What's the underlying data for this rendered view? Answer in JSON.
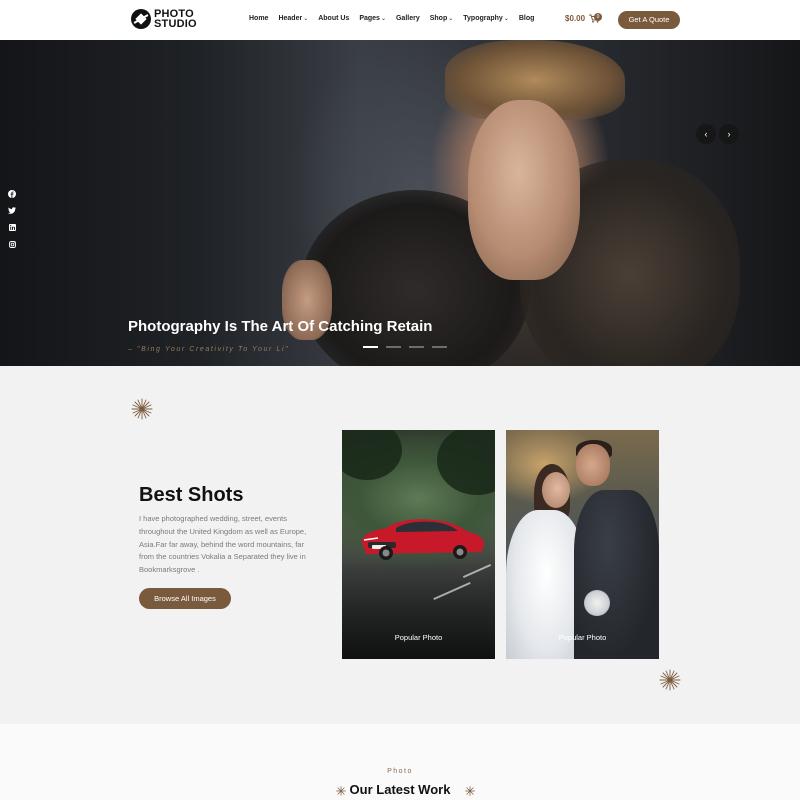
{
  "brand": {
    "line1": "PHOTO",
    "line2": "STUDIO"
  },
  "nav": {
    "items": [
      {
        "label": "Home",
        "dropdown": false
      },
      {
        "label": "Header",
        "dropdown": true
      },
      {
        "label": "About Us",
        "dropdown": false
      },
      {
        "label": "Pages",
        "dropdown": true
      },
      {
        "label": "Gallery",
        "dropdown": false
      },
      {
        "label": "Shop",
        "dropdown": true
      },
      {
        "label": "Typography",
        "dropdown": true
      },
      {
        "label": "Blog",
        "dropdown": false
      }
    ],
    "caret": "⌄"
  },
  "cart": {
    "price": "$0.00",
    "count": "0"
  },
  "quote_button": "Get A Quote",
  "social": [
    "facebook-icon",
    "twitter-icon",
    "linkedin-icon",
    "instagram-icon"
  ],
  "hero": {
    "title": "Photography Is The Art Of Catching Retain",
    "subtitle": "– \"Bing Your Creativity To Your Li\"",
    "prev": "‹",
    "next": "›",
    "slides": 4,
    "active_slide": 1
  },
  "shots": {
    "title": "Best Shots",
    "text": "I have photographed wedding, street, events throughout the United Kingdom as well as Europe, Asia.Far far away, behind the word mountains, far from the countries Vokalia a Separated they live in Bookmarksgrove .",
    "button": "Browse All Images",
    "cards": [
      {
        "caption": "Popular Photo"
      },
      {
        "caption": "Popular Photo"
      }
    ]
  },
  "latest": {
    "eyebrow": "Photo",
    "title": "Our Latest Work"
  },
  "colors": {
    "accent": "#7a5a3c",
    "section_bg": "#f2f2f2"
  }
}
